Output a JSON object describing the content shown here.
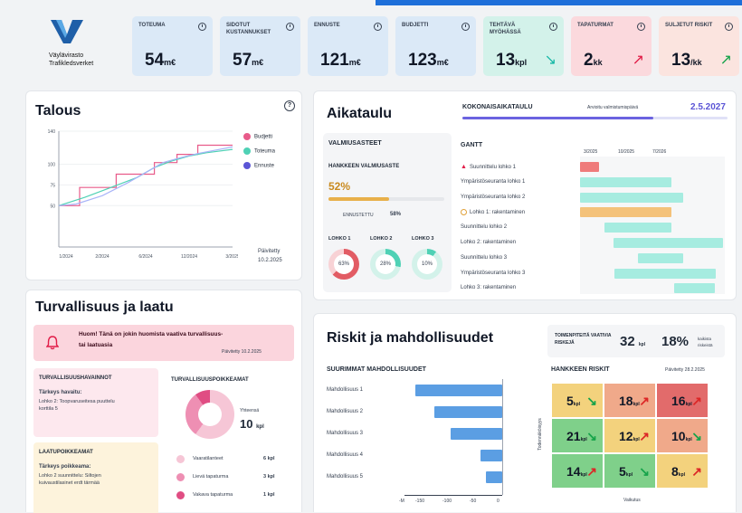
{
  "top_accent_color": "#1e6fd9",
  "brand": {
    "logo_icon": "vayla-logo-v",
    "line1": "Väylävirasto",
    "line2": "Trafikledsverket"
  },
  "kpis": [
    {
      "label": "TOTEUMA",
      "value": "54",
      "unit": "m€",
      "bg": "#dbe9f7",
      "icon": "clock-icon"
    },
    {
      "label": "SIDOTUT KUSTANNUKSET",
      "value": "57",
      "unit": "m€",
      "bg": "#dbe9f7",
      "icon": "clock-icon"
    },
    {
      "label": "ENNUSTE",
      "value": "121",
      "unit": "m€",
      "bg": "#dbe9f7",
      "icon": "clock-icon"
    },
    {
      "label": "BUDJETTI",
      "value": "123",
      "unit": "m€",
      "bg": "#dbe9f7",
      "icon": "clock-icon"
    },
    {
      "label": "TEHTÄVÄ MYÖHÄSSÄ",
      "value": "13",
      "unit": "kpl",
      "bg": "#d3f2ea",
      "icon": "clock-icon",
      "arrow": "↘",
      "arrow_color": "#14b8a6"
    },
    {
      "label": "TAPATURMAT",
      "value": "2",
      "unit": "kk",
      "bg": "#fbd9dd",
      "icon": "clock-icon",
      "arrow": "↗",
      "arrow_color": "#e11d48"
    },
    {
      "label": "SULJETUT RISKIT",
      "value": "13",
      "unit": "/kk",
      "bg": "#fbe4df",
      "icon": "clock-icon",
      "arrow": "↗",
      "arrow_color": "#16a34a"
    }
  ],
  "talous": {
    "title": "Talous",
    "help_icon": "question-icon",
    "legend": [
      {
        "name": "Budjetti",
        "color": "#e85b8a"
      },
      {
        "name": "Toteuma",
        "color": "#4fd1b5"
      },
      {
        "name": "Ennuste",
        "color": "#5b55d6"
      }
    ],
    "updated_label": "Päivitetty",
    "updated_date": "10.2.2025"
  },
  "chart_data": {
    "type": "line",
    "x": [
      "1/2024",
      "2/2024",
      "6/2024",
      "12/2024",
      "3/2025"
    ],
    "ylim": [
      0,
      140
    ],
    "yticks": [
      "140",
      "100",
      "75",
      "50"
    ],
    "series": [
      {
        "name": "Budjetti",
        "color": "#e85b8a",
        "points": [
          [
            0,
            50
          ],
          [
            0.12,
            50
          ],
          [
            0.12,
            72
          ],
          [
            0.33,
            72
          ],
          [
            0.33,
            88
          ],
          [
            0.55,
            88
          ],
          [
            0.55,
            102
          ],
          [
            0.68,
            102
          ],
          [
            0.68,
            112
          ],
          [
            0.8,
            112
          ],
          [
            0.8,
            123
          ],
          [
            1,
            123
          ]
        ]
      },
      {
        "name": "Toteuma",
        "color": "#4fd1b5",
        "points": [
          [
            0,
            50
          ],
          [
            0.15,
            60
          ],
          [
            0.3,
            72
          ],
          [
            0.45,
            84
          ],
          [
            0.55,
            96
          ],
          [
            0.65,
            104
          ],
          [
            0.75,
            110
          ],
          [
            0.85,
            114
          ],
          [
            1,
            118
          ]
        ]
      },
      {
        "name": "Ennuste",
        "color": "#a8b4f8",
        "points": [
          [
            0,
            50
          ],
          [
            0.1,
            52
          ],
          [
            0.25,
            62
          ],
          [
            0.4,
            78
          ],
          [
            0.5,
            90
          ],
          [
            0.6,
            102
          ],
          [
            0.7,
            108
          ],
          [
            0.8,
            113
          ],
          [
            1,
            121
          ]
        ]
      }
    ]
  },
  "aikataulu": {
    "title": "Aikataulu",
    "overall_label": "KOKONAISAIKATAULU",
    "forecast_label": "Arvioitu valmistumispäivä",
    "forecast_date": "2.5.2027",
    "overall_progress": 0.72,
    "valmius": {
      "title": "VALMIUSASTEET",
      "project_label": "HANKKEEN VALMIUSASTE",
      "percent": "52%",
      "progress": 0.52,
      "forecast_label": "ENNUSTETTU",
      "forecast_value": "58%",
      "lohkot": [
        {
          "label": "LOHKO 1",
          "value": "63%",
          "fraction": 0.63,
          "color": "#e25c64",
          "track": "#f8d2d5"
        },
        {
          "label": "LOHKO 2",
          "value": "28%",
          "fraction": 0.28,
          "color": "#4fd1b5",
          "track": "#d3f2ea"
        },
        {
          "label": "LOHKO 3",
          "value": "10%",
          "fraction": 0.1,
          "color": "#4fd1b5",
          "track": "#d3f2ea"
        }
      ]
    },
    "gantt": {
      "title": "GANTT",
      "dates": [
        "3/2025",
        "10/2025",
        "7/2026"
      ],
      "rows": [
        {
          "label": "Suunnittelu lohko 1",
          "start": 0.0,
          "end": 0.13,
          "color": "#ef7b7b",
          "icon": "warning-icon"
        },
        {
          "label": "Ympäristöseuranta lohko 1",
          "start": 0.0,
          "end": 0.63,
          "color": "#a6ece0"
        },
        {
          "label": "Ympäristöseuranta lohko 2",
          "start": 0.0,
          "end": 0.71,
          "color": "#a6ece0"
        },
        {
          "label": "Lohko 1: rakentaminen",
          "start": 0.0,
          "end": 0.63,
          "color": "#f4c27a",
          "icon": "pending-icon"
        },
        {
          "label": "Suunnittelu lohko 2",
          "start": 0.17,
          "end": 0.63,
          "color": "#a6ece0"
        },
        {
          "label": "Lohko 2: rakentaminen",
          "start": 0.23,
          "end": 0.99,
          "color": "#a6ece0"
        },
        {
          "label": "Suunnittelu lohko 3",
          "start": 0.4,
          "end": 0.71,
          "color": "#a6ece0"
        },
        {
          "label": "Ympäristöseuranta lohko 3",
          "start": 0.24,
          "end": 0.94,
          "color": "#a6ece0"
        },
        {
          "label": "Lohko 3: rakentaminen",
          "start": 0.65,
          "end": 0.93,
          "color": "#a6ece0"
        }
      ]
    }
  },
  "turvallisuus": {
    "title": "Turvallisuus ja laatu",
    "alert_icon": "bell-icon",
    "alert_text": "Huom! Tänä on jokin huomista vaativa turvallisuus- tai laatuasia",
    "alert_updated": "Päivitetty 10.2.2025",
    "havainnot": {
      "title": "TURVALLISUUSHAVAINNOT",
      "subtitle": "Tärkeys havaitu:",
      "text": "Lohko 2: Toopvaruseitesa puuttelu korttila 5"
    },
    "laatu": {
      "title": "LAATUPOIKKEAMAT",
      "subtitle": "Tärkeys poikkeama:",
      "text": "Lohko 2 suunnittelu: Siltojen kuivaustilasinet erdt tärmää"
    },
    "poikkeamat": {
      "title": "TURVALLISUUSPOIKKEAMAT",
      "total_label": "Yhteensä",
      "total_value": "10",
      "total_unit": "kpl",
      "items": [
        {
          "label": "Vaaratilanteet",
          "value": "6 kpl",
          "count": 6,
          "color": "#f6c6d6"
        },
        {
          "label": "Lievä tapaturma",
          "value": "3 kpl",
          "count": 3,
          "color": "#ee8fb3"
        },
        {
          "label": "Vakava tapaturma",
          "value": "1 kpl",
          "count": 1,
          "color": "#e04d83"
        }
      ]
    }
  },
  "riskit": {
    "title": "Riskit ja mahdollisuudet",
    "kpi_label": "TOIMENPITEITÄ VAATIVIA RISKEJÄ",
    "kpi_value": "32",
    "kpi_unit": "kpl",
    "kpi_percent": "18%",
    "kpi_percent_label": "kaikista riskeistä",
    "mahdollisuudet": {
      "title": "SUURIMMAT MAHDOLLISUUDET",
      "axis": [
        "-M",
        "-150",
        "-100",
        "-50",
        "0"
      ],
      "items": [
        {
          "label": "Mahdollisuus 1",
          "value": -160
        },
        {
          "label": "Mahdollisuus 2",
          "value": -125
        },
        {
          "label": "Mahdollisuus 3",
          "value": -95
        },
        {
          "label": "Mahdollisuus 4",
          "value": -40
        },
        {
          "label": "Mahdollisuus 5",
          "value": -30
        }
      ]
    },
    "hankkeen_riskit": {
      "title": "HANKKEEN RISKIT",
      "updated": "Päivitetty 28.2.2025",
      "y_label": "Todennäköisyys",
      "x_label": "Vaikutus",
      "cells": [
        {
          "value": "5",
          "unit": "kpl",
          "color": "#f3d27d",
          "arrow": "↘",
          "arrow_color": "#16a34a"
        },
        {
          "value": "18",
          "unit": "kpl",
          "color": "#f0a98a",
          "arrow": "↗",
          "arrow_color": "#dc2626"
        },
        {
          "value": "16",
          "unit": "kpl",
          "color": "#e26b6b",
          "arrow": "↗",
          "arrow_color": "#dc2626"
        },
        {
          "value": "21",
          "unit": "kpl",
          "color": "#7fd08a",
          "arrow": "↘",
          "arrow_color": "#16a34a"
        },
        {
          "value": "12",
          "unit": "kpl",
          "color": "#f3d27d",
          "arrow": "↗",
          "arrow_color": "#dc2626"
        },
        {
          "value": "10",
          "unit": "kpl",
          "color": "#f0a98a",
          "arrow": "↘",
          "arrow_color": "#16a34a"
        },
        {
          "value": "14",
          "unit": "kpl",
          "color": "#7fd08a",
          "arrow": "↗",
          "arrow_color": "#dc2626"
        },
        {
          "value": "5",
          "unit": "kpl",
          "color": "#7fd08a",
          "arrow": "↘",
          "arrow_color": "#16a34a"
        },
        {
          "value": "8",
          "unit": "kpl",
          "color": "#f3d27d",
          "arrow": "↗",
          "arrow_color": "#dc2626"
        }
      ]
    }
  }
}
